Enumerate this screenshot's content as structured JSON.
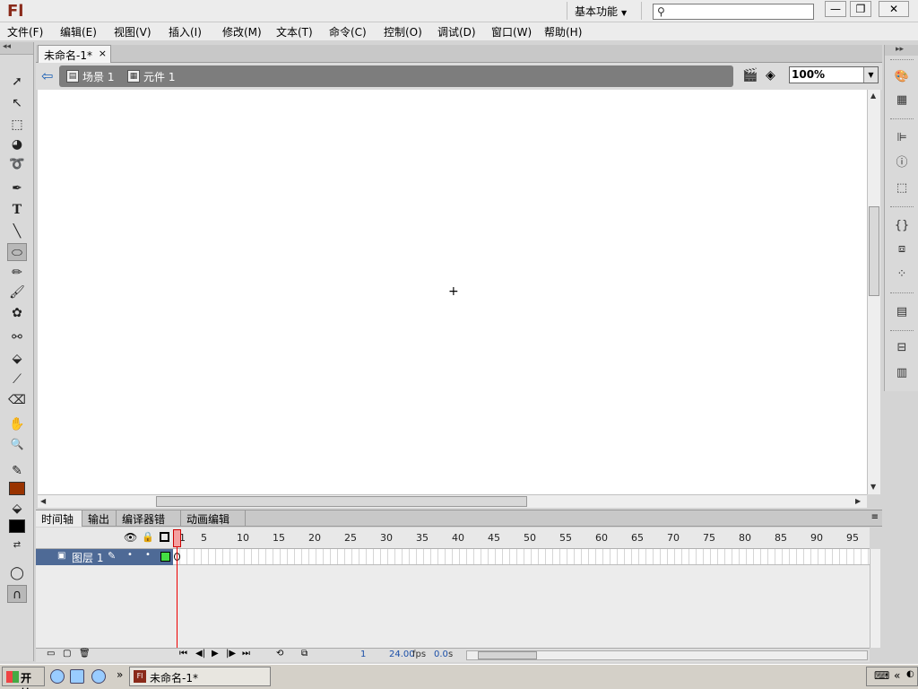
{
  "app": {
    "logo": "Fl",
    "workspace_label": "基本功能",
    "search_placeholder": ""
  },
  "window_controls": {
    "minimize": "—",
    "restore": "❐",
    "close": "✕"
  },
  "menu": [
    {
      "label": "文件(F)"
    },
    {
      "label": "编辑(E)"
    },
    {
      "label": "视图(V)"
    },
    {
      "label": "插入(I)"
    },
    {
      "label": "修改(M)"
    },
    {
      "label": "文本(T)"
    },
    {
      "label": "命令(C)"
    },
    {
      "label": "控制(O)"
    },
    {
      "label": "调试(D)"
    },
    {
      "label": "窗口(W)"
    },
    {
      "label": "帮助(H)"
    }
  ],
  "document": {
    "tab_label": "未命名-1*",
    "tab_close": "×"
  },
  "editbar": {
    "scene_label": "场景 1",
    "symbol_label": "元件 1",
    "zoom_value": "100%"
  },
  "tools": [
    {
      "name": "selection-tool-icon",
      "glyph": "➚"
    },
    {
      "name": "subselection-tool-icon",
      "glyph": "↖"
    },
    {
      "name": "free-transform-tool-icon",
      "glyph": "⬚"
    },
    {
      "name": "3d-rotation-tool-icon",
      "glyph": "◕"
    },
    {
      "name": "lasso-tool-icon",
      "glyph": "➰"
    },
    {
      "name": "pen-tool-icon",
      "glyph": "✒"
    },
    {
      "name": "text-tool-icon",
      "glyph": "T"
    },
    {
      "name": "line-tool-icon",
      "glyph": "╲"
    },
    {
      "name": "oval-tool-icon",
      "glyph": "⬭"
    },
    {
      "name": "pencil-tool-icon",
      "glyph": "✏"
    },
    {
      "name": "brush-tool-icon",
      "glyph": "🖌"
    },
    {
      "name": "deco-tool-icon",
      "glyph": "✿"
    },
    {
      "name": "bone-tool-icon",
      "glyph": "⚯"
    },
    {
      "name": "paint-bucket-tool-icon",
      "glyph": "⬙"
    },
    {
      "name": "eyedropper-tool-icon",
      "glyph": "⟋"
    },
    {
      "name": "eraser-tool-icon",
      "glyph": "⌫"
    },
    {
      "name": "hand-tool-icon",
      "glyph": "✋"
    },
    {
      "name": "zoom-tool-icon",
      "glyph": "🔍"
    }
  ],
  "colors": {
    "stroke": "#993300",
    "fill": "#000000",
    "layer_color": "#44dd44"
  },
  "timeline": {
    "tabs": [
      "时间轴",
      "输出",
      "编译器错误",
      "动画编辑器"
    ],
    "frame_numbers": [
      "1",
      "5",
      "10",
      "15",
      "20",
      "25",
      "30",
      "35",
      "40",
      "45",
      "50",
      "55",
      "60",
      "65",
      "70",
      "75",
      "80",
      "85",
      "90",
      "95"
    ],
    "layer_name": "图层 1",
    "current_frame": "1",
    "fps": "24.00",
    "fps_unit": "fps",
    "elapsed": "0.0",
    "elapsed_unit": "s"
  },
  "taskbar": {
    "start_label": "开始",
    "task_label": "未命名-1*",
    "overflow": "»"
  }
}
